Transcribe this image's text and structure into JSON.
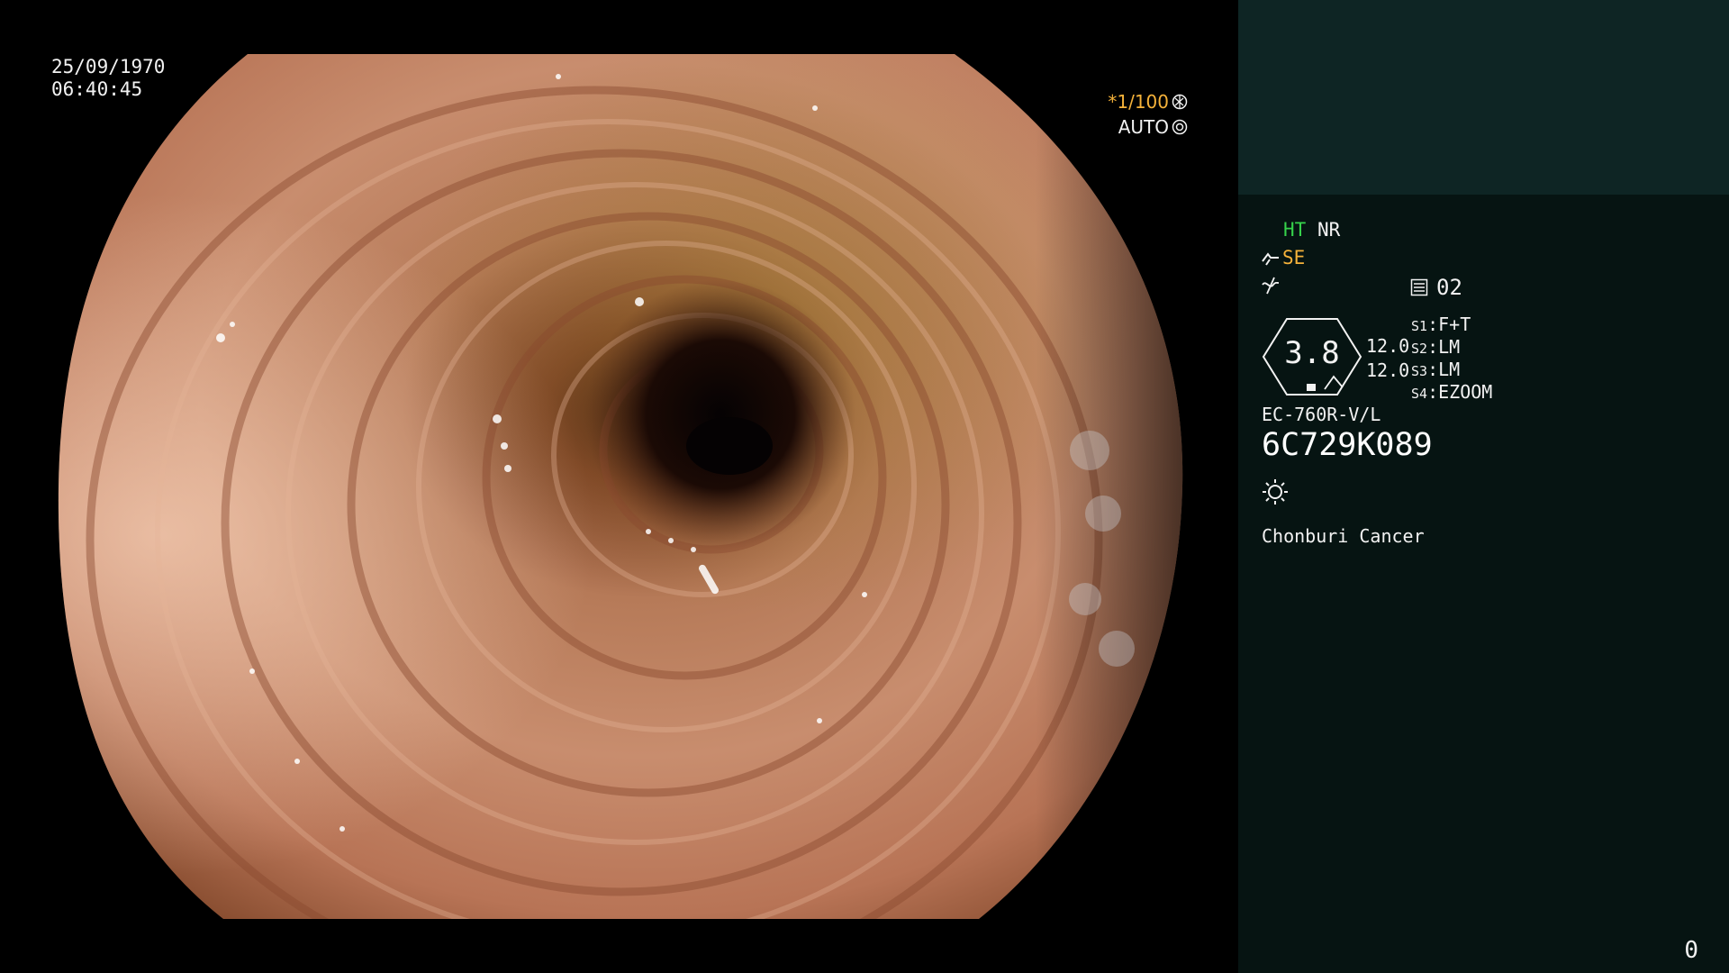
{
  "osd": {
    "date": "25/09/1970",
    "time": "06:40:45",
    "shutter": "*1/100",
    "shutter_icon": "aperture-icon",
    "mode": "AUTO",
    "mode_icon": "iris-icon"
  },
  "panel": {
    "ht": "HT",
    "nr": "NR",
    "se": "SE",
    "se_icon": "scope-icon",
    "enhance_icon": "wave-slash-icon",
    "memo_icon": "memory-icon",
    "memo_value": "02",
    "ring_value": "3.8",
    "values": [
      "12.0",
      "12.0"
    ],
    "switches": [
      {
        "key": "S1",
        "value": "F+T"
      },
      {
        "key": "S2",
        "value": "LM"
      },
      {
        "key": "S3",
        "value": "LM"
      },
      {
        "key": "S4",
        "value": "EZOOM"
      }
    ],
    "model": "EC-760R-V/L",
    "serial": "6C729K089",
    "light_icon": "sun-icon",
    "hospital": "Chonburi Cancer"
  },
  "counter": "0",
  "colors": {
    "panel_bg": "#061412",
    "panel_top": "#0e2524",
    "accent_green": "#36d24b",
    "accent_orange": "#f5b23a"
  }
}
